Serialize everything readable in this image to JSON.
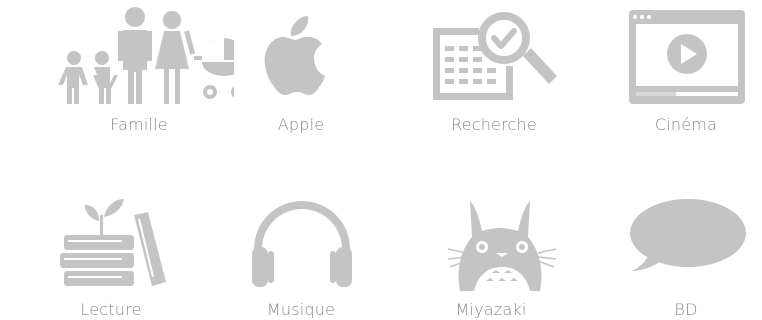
{
  "icon_color": "#c4c4c4",
  "label_color": "#888888",
  "categories": [
    {
      "label": "Famille",
      "icon": "family-icon"
    },
    {
      "label": "Apple",
      "icon": "apple-icon"
    },
    {
      "label": "Recherche",
      "icon": "search-document-icon"
    },
    {
      "label": "Cinéma",
      "icon": "video-player-icon"
    },
    {
      "label": "Lecture",
      "icon": "books-plant-icon"
    },
    {
      "label": "Musique",
      "icon": "headphones-icon"
    },
    {
      "label": "Miyazaki",
      "icon": "totoro-icon"
    },
    {
      "label": "BD",
      "icon": "speech-bubble-icon"
    }
  ]
}
